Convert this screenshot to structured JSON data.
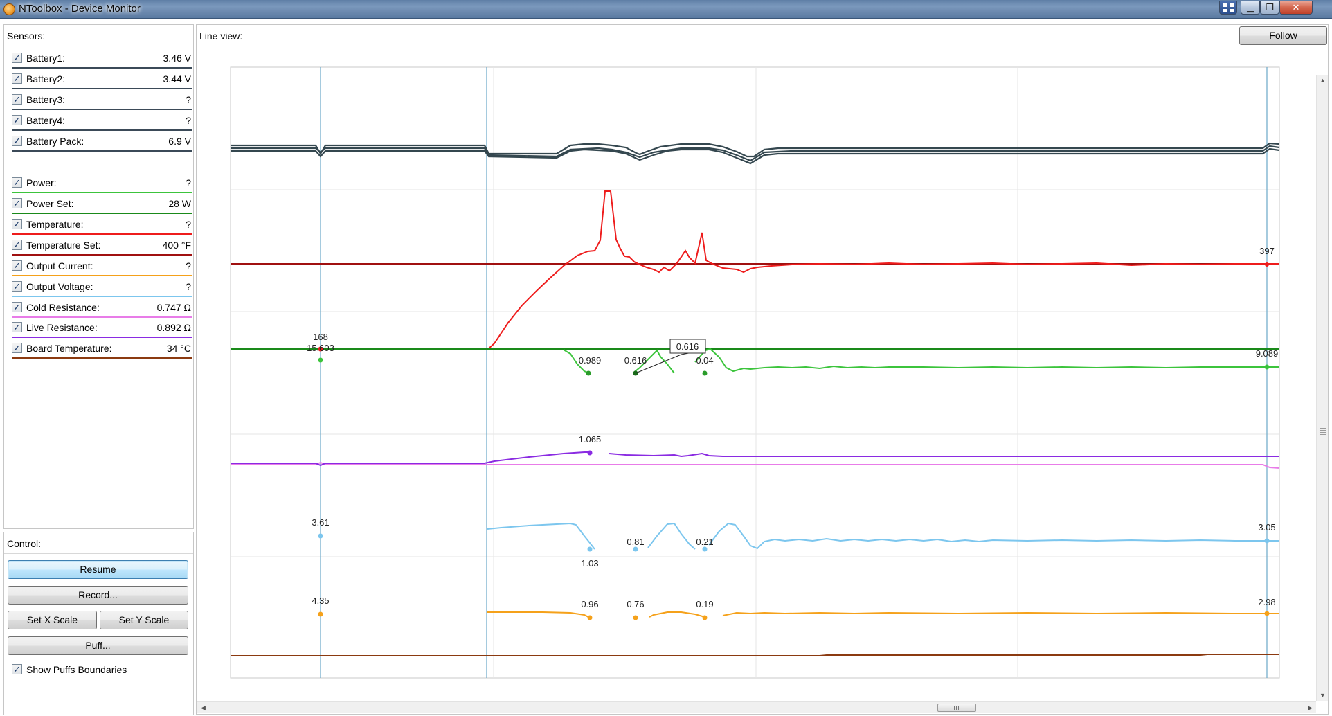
{
  "window": {
    "title": "NToolbox - Device Monitor",
    "minimize": "▁",
    "maximize": "❐",
    "close": "✕"
  },
  "sensors": {
    "header": "Sensors:",
    "items": [
      {
        "label": "Battery1:",
        "value": "3.46 V",
        "checked": "✓",
        "color": "#3b4a58"
      },
      {
        "label": "Battery2:",
        "value": "3.44 V",
        "checked": "✓",
        "color": "#3b4a58"
      },
      {
        "label": "Battery3:",
        "value": "?",
        "checked": "✓",
        "color": "#3b4a58"
      },
      {
        "label": "Battery4:",
        "value": "?",
        "checked": "✓",
        "color": "#3b4a58"
      },
      {
        "label": "Battery Pack:",
        "value": "6.9 V",
        "checked": "✓",
        "color": "#3b4a58"
      },
      {
        "label": "Power:",
        "value": "?",
        "checked": "✓",
        "color": "#3cc43c"
      },
      {
        "label": "Power Set:",
        "value": "28 W",
        "checked": "✓",
        "color": "#1a8a1a"
      },
      {
        "label": "Temperature:",
        "value": "?",
        "checked": "✓",
        "color": "#ee1c1c"
      },
      {
        "label": "Temperature Set:",
        "value": "400 °F",
        "checked": "✓",
        "color": "#a01010"
      },
      {
        "label": "Output Current:",
        "value": "?",
        "checked": "✓",
        "color": "#f5a11a"
      },
      {
        "label": "Output Voltage:",
        "value": "?",
        "checked": "✓",
        "color": "#7cc6ee"
      },
      {
        "label": "Cold Resistance:",
        "value": "0.747 Ω",
        "checked": "✓",
        "color": "#e87ce8"
      },
      {
        "label": "Live Resistance:",
        "value": "0.892 Ω",
        "checked": "✓",
        "color": "#8a2be2"
      },
      {
        "label": "Board Temperature:",
        "value": "34 °C",
        "checked": "✓",
        "color": "#8b3a10"
      }
    ]
  },
  "control": {
    "header": "Control:",
    "resume": "Resume",
    "record": "Record...",
    "set_x_scale": "Set X Scale",
    "set_y_scale": "Set Y Scale",
    "puff": "Puff...",
    "show_puffs": {
      "label": "Show Puffs Boundaries",
      "checked": "✓"
    }
  },
  "lineview": {
    "header": "Line view:",
    "follow": "Follow",
    "labels": {
      "temp_397": "397",
      "power_168": "168",
      "power_15603": "15.603",
      "power_0989": "0.989",
      "power_0616": "0.616",
      "power_004": "0.04",
      "power_9089": "9.089",
      "tooltip_0616": "0.616",
      "res_1065": "1.065",
      "volt_361": "3.61",
      "volt_103": "1.03",
      "volt_081": "0.81",
      "volt_021": "0.21",
      "volt_305": "3.05",
      "cur_435": "4.35",
      "cur_096": "0.96",
      "cur_076": "0.76",
      "cur_019": "0.19",
      "cur_298": "2.98"
    }
  }
}
